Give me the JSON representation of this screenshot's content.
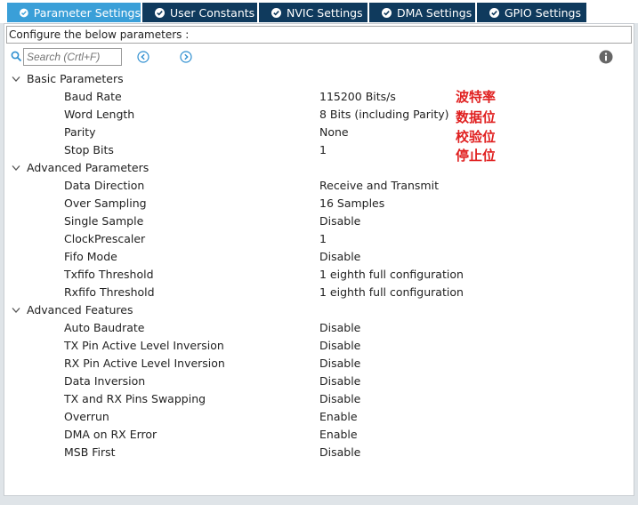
{
  "tabs": [
    {
      "label": "Parameter Settings",
      "active": true
    },
    {
      "label": "User Constants",
      "active": false
    },
    {
      "label": "NVIC Settings",
      "active": false
    },
    {
      "label": "DMA Settings",
      "active": false
    },
    {
      "label": "GPIO Settings",
      "active": false
    }
  ],
  "configure_label": "Configure the below parameters :",
  "search": {
    "placeholder": "Search (Crtl+F)"
  },
  "groups": [
    {
      "title": "Basic Parameters",
      "params": [
        {
          "name": "Baud Rate",
          "value": "115200 Bits/s"
        },
        {
          "name": "Word Length",
          "value": "8 Bits (including Parity)"
        },
        {
          "name": "Parity",
          "value": "None"
        },
        {
          "name": "Stop Bits",
          "value": "1"
        }
      ]
    },
    {
      "title": "Advanced Parameters",
      "params": [
        {
          "name": "Data Direction",
          "value": "Receive and Transmit"
        },
        {
          "name": "Over Sampling",
          "value": "16 Samples"
        },
        {
          "name": "Single Sample",
          "value": "Disable"
        },
        {
          "name": "ClockPrescaler",
          "value": "1"
        },
        {
          "name": "Fifo Mode",
          "value": "Disable"
        },
        {
          "name": "Txfifo Threshold",
          "value": "1 eighth full configuration"
        },
        {
          "name": "Rxfifo Threshold",
          "value": "1 eighth full configuration"
        }
      ]
    },
    {
      "title": "Advanced Features",
      "params": [
        {
          "name": "Auto Baudrate",
          "value": "Disable"
        },
        {
          "name": "TX Pin Active Level Inversion",
          "value": "Disable"
        },
        {
          "name": "RX Pin Active Level Inversion",
          "value": "Disable"
        },
        {
          "name": "Data Inversion",
          "value": "Disable"
        },
        {
          "name": "TX and RX Pins Swapping",
          "value": "Disable"
        },
        {
          "name": "Overrun",
          "value": "Enable"
        },
        {
          "name": "DMA on RX Error",
          "value": "Enable"
        },
        {
          "name": "MSB First",
          "value": "Disable"
        }
      ]
    }
  ],
  "annotations": [
    "波特率",
    "数据位",
    "校验位",
    "停止位"
  ],
  "colors": {
    "tab_active": "#3a9fd8",
    "tab_inactive": "#0f3a5d",
    "annotation": "#e02020",
    "link_blue": "#2f8fd0"
  }
}
